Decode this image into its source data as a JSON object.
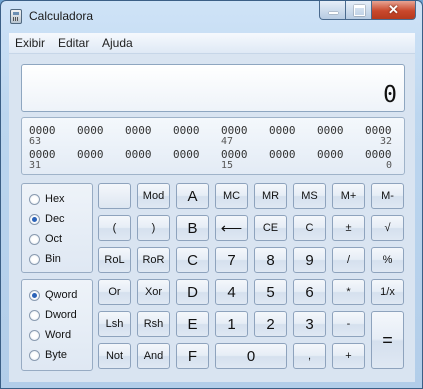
{
  "window": {
    "title": "Calculadora",
    "close_glyph": "✕"
  },
  "menu": [
    "Exibir",
    "Editar",
    "Ajuda"
  ],
  "display": {
    "value": "0"
  },
  "bits": {
    "row1": [
      "0000",
      "0000",
      "0000",
      "0000",
      "0000",
      "0000",
      "0000",
      "0000"
    ],
    "row1_labels": [
      "63",
      "47",
      "32"
    ],
    "row2": [
      "0000",
      "0000",
      "0000",
      "0000",
      "0000",
      "0000",
      "0000",
      "0000"
    ],
    "row2_labels": [
      "31",
      "15",
      "0"
    ]
  },
  "base_options": [
    {
      "label": "Hex",
      "selected": false
    },
    {
      "label": "Dec",
      "selected": true
    },
    {
      "label": "Oct",
      "selected": false
    },
    {
      "label": "Bin",
      "selected": false
    }
  ],
  "word_options": [
    {
      "label": "Qword",
      "selected": true
    },
    {
      "label": "Dword",
      "selected": false
    },
    {
      "label": "Word",
      "selected": false
    },
    {
      "label": "Byte",
      "selected": false
    }
  ],
  "buttons": {
    "row1": [
      "",
      "Mod",
      "A",
      "MC",
      "MR",
      "MS",
      "M+",
      "M-"
    ],
    "row2": [
      "(",
      ")",
      "B",
      "⟵",
      "CE",
      "C",
      "±",
      "√"
    ],
    "row3": [
      "RoL",
      "RoR",
      "C",
      "7",
      "8",
      "9",
      "/",
      "%"
    ],
    "row4": [
      "Or",
      "Xor",
      "D",
      "4",
      "5",
      "6",
      "*",
      "1/x"
    ],
    "row5": [
      "Lsh",
      "Rsh",
      "E",
      "1",
      "2",
      "3",
      "-"
    ],
    "row6": [
      "Not",
      "And",
      "F",
      "0",
      ",",
      "+"
    ],
    "equals": "="
  },
  "icons": [
    "calculator-app-icon",
    "minimize-icon",
    "maximize-icon",
    "close-icon"
  ]
}
